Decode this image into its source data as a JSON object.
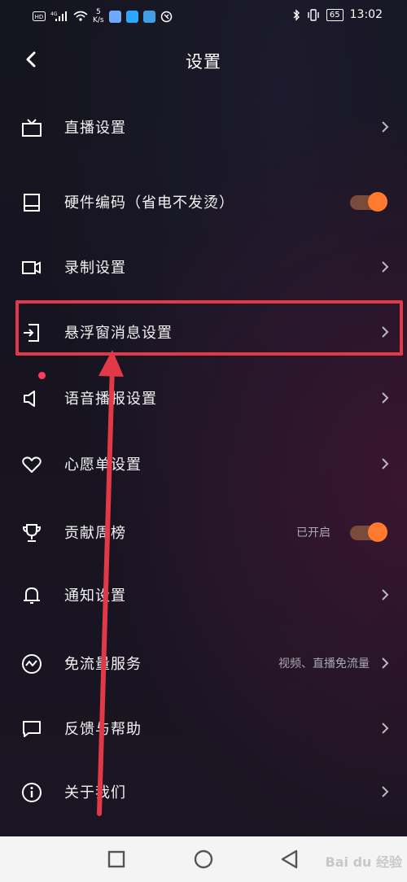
{
  "status_bar": {
    "left_icons": [
      "hd-icon",
      "4g-signal-icon",
      "wifi-icon"
    ],
    "speed_value": "5",
    "speed_unit": "K/s",
    "battery": "65",
    "time": "13:02"
  },
  "header": {
    "title": "设置"
  },
  "settings": [
    {
      "label": "直播设置",
      "icon": "tv-icon"
    },
    {
      "label": "硬件编码（省电不发烫）",
      "icon": "hardware-icon",
      "toggle": true
    },
    {
      "label": "录制设置",
      "icon": "camera-icon"
    },
    {
      "label": "悬浮窗消息设置",
      "icon": "floating-window-icon",
      "highlighted": true
    },
    {
      "label": "语音播报设置",
      "icon": "speaker-icon",
      "badge": true
    },
    {
      "label": "心愿单设置",
      "icon": "heart-icon"
    },
    {
      "label": "贡献周榜",
      "icon": "trophy-icon",
      "status": "已开启",
      "toggle": true
    },
    {
      "label": "通知设置",
      "icon": "bell-icon"
    },
    {
      "label": "免流量服务",
      "icon": "data-wave-icon",
      "status": "视频、直播免流量"
    },
    {
      "label": "反馈与帮助",
      "icon": "feedback-icon"
    },
    {
      "label": "关于我们",
      "icon": "info-icon"
    }
  ],
  "colors": {
    "accent": "#ff7a2e",
    "highlight": "#e23948",
    "badge": "#fe3b5b"
  },
  "nav_bar": {
    "watermark": "Bai du 经验"
  }
}
